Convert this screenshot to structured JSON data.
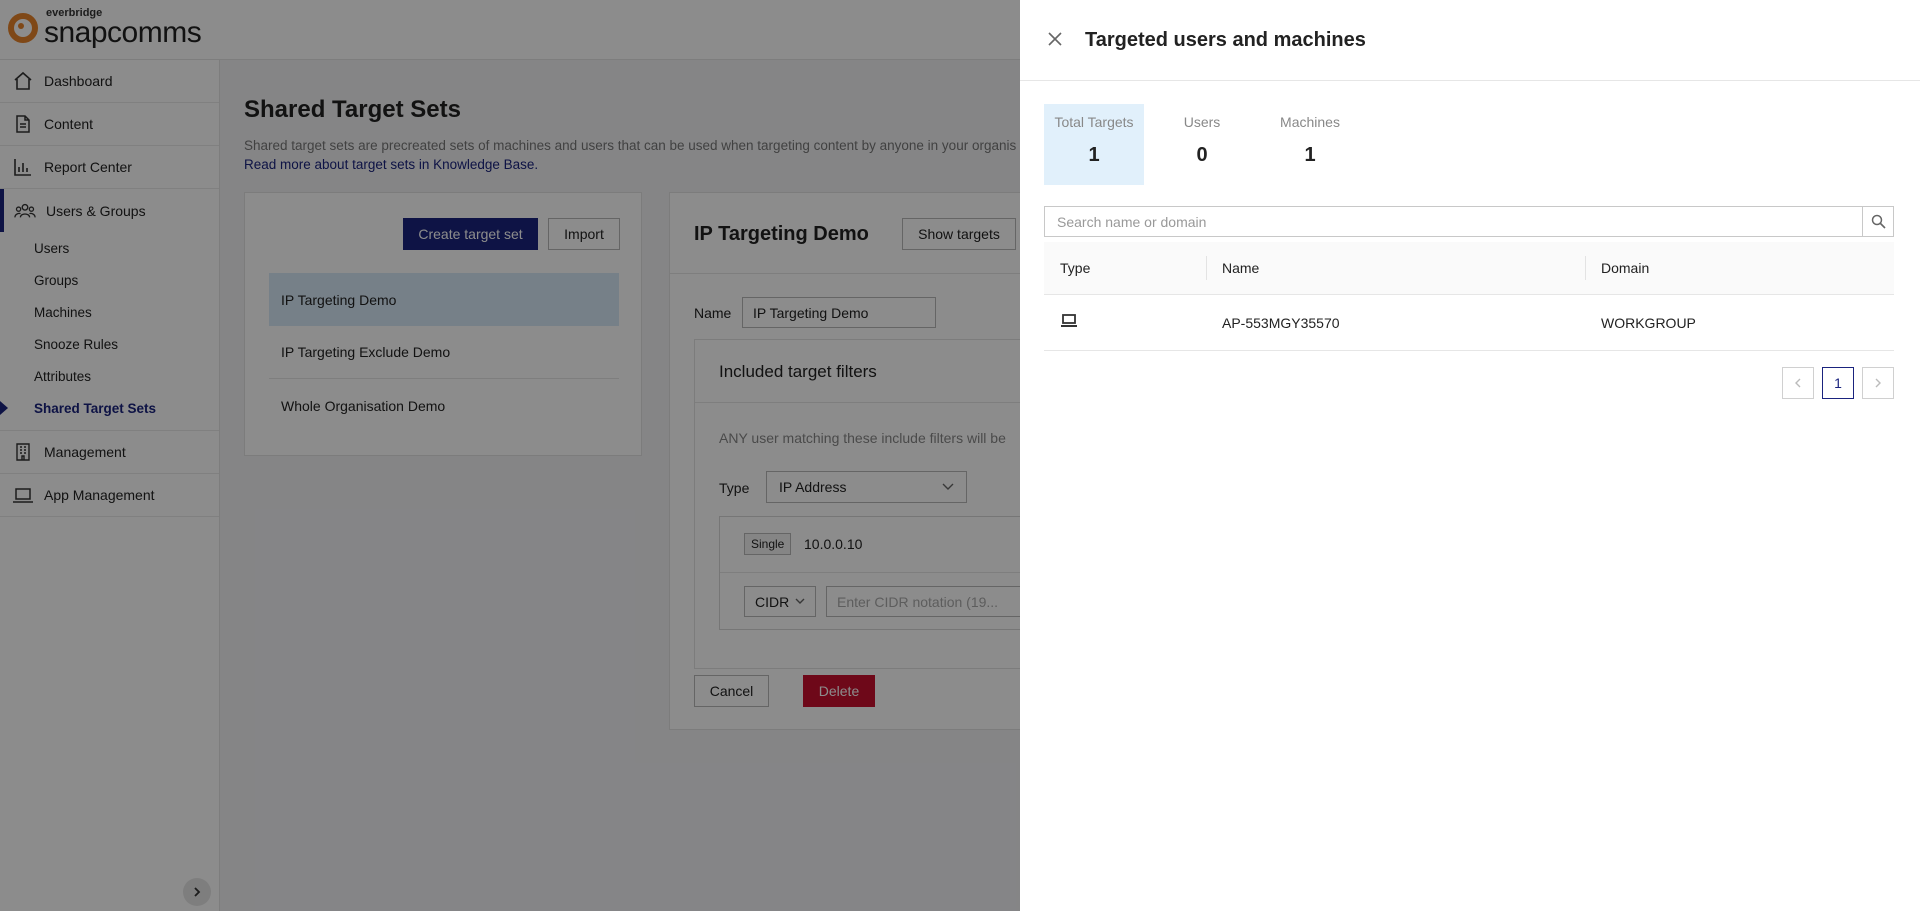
{
  "brand": {
    "small": "everbridge",
    "big": "snapcomms",
    "accent": "#e8832a"
  },
  "sidebar": {
    "items": [
      {
        "label": "Dashboard",
        "icon": "home-icon"
      },
      {
        "label": "Content",
        "icon": "document-icon"
      },
      {
        "label": "Report Center",
        "icon": "chart-icon"
      },
      {
        "label": "Users & Groups",
        "icon": "users-icon"
      }
    ],
    "sub_items": [
      "Users",
      "Groups",
      "Machines",
      "Snooze Rules",
      "Attributes",
      "Shared Target Sets"
    ],
    "bottom_items": [
      {
        "label": "Management",
        "icon": "building-icon"
      },
      {
        "label": "App Management",
        "icon": "laptop-icon"
      }
    ]
  },
  "main": {
    "title": "Shared Target Sets",
    "description": "Shared target sets are precreated sets of machines and users that can be used when targeting content by anyone in your organis",
    "kb_link": "Read more about target sets in Knowledge Base.",
    "create_button": "Create target set",
    "import_button": "Import",
    "target_sets": [
      "IP Targeting Demo",
      "IP Targeting Exclude Demo",
      "Whole Organisation Demo"
    ]
  },
  "detail": {
    "title": "IP Targeting Demo",
    "show_targets": "Show targets",
    "name_label": "Name",
    "name_value": "IP Targeting Demo",
    "filters_title": "Included target filters",
    "filters_desc": "ANY user matching these include filters will be",
    "type_label": "Type",
    "type_value": "IP Address",
    "single_tag": "Single",
    "ip_value": "10.0.0.10",
    "cidr_label": "CIDR",
    "cidr_placeholder": "Enter CIDR notation (19...",
    "cancel_button": "Cancel",
    "delete_button": "Delete",
    "primary_color": "#1a237e",
    "danger_color": "#c8102e"
  },
  "drawer": {
    "title": "Targeted users and machines",
    "stats": [
      {
        "label": "Total Targets",
        "value": "1"
      },
      {
        "label": "Users",
        "value": "0"
      },
      {
        "label": "Machines",
        "value": "1"
      }
    ],
    "search_placeholder": "Search name or domain",
    "columns": [
      "Type",
      "Name",
      "Domain"
    ],
    "rows": [
      {
        "type_icon": "computer-icon",
        "name": "AP-553MGY35570",
        "domain": "WORKGROUP"
      }
    ],
    "pagination": {
      "prev": "<",
      "current": "1",
      "next": ">"
    }
  }
}
